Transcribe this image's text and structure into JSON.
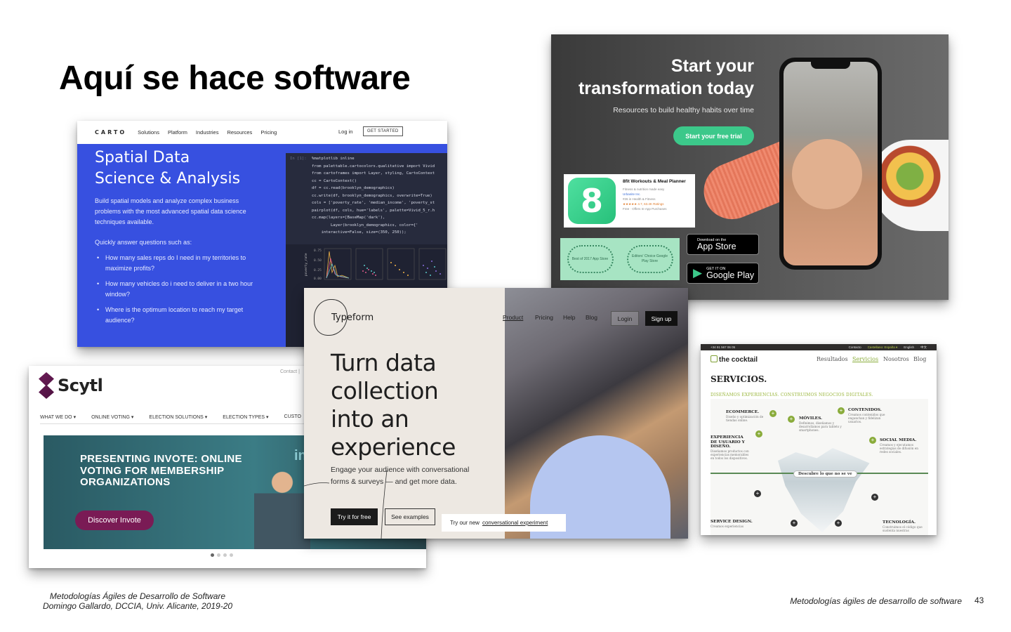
{
  "slide": {
    "title": "Aquí se hace software",
    "footer_line1": "Metodologías Ágiles de Desarrollo de Software",
    "footer_line2": "Domingo Gallardo, DCCIA, Univ. Alicante, 2019-20",
    "footer_right": "Metodologías ágiles de desarrollo de software",
    "page_number": "43"
  },
  "carto": {
    "logo": "CARTO",
    "nav": [
      "Solutions",
      "Platform",
      "Industries",
      "Resources",
      "Pricing"
    ],
    "login": "Log in",
    "cta": "GET STARTED",
    "headline_1": "Spatial Data",
    "headline_2": "Science & Analysis",
    "body": "Build spatial models and analyze complex business problems with the most advanced spatial data science techniques available.",
    "question_intro": "Quickly answer questions such as:",
    "bullets": [
      "How many sales reps do I need in my territories to maximize profits?",
      "How many vehicles do i need to deliver in a two hour window?",
      "Where is the optimum location to reach my target audience?"
    ],
    "code_line_no": "In [1]:",
    "code_lines": [
      "%matplotlib inline",
      "from palettable.cartocolors.qualitative import Vivid",
      "from cartoframes import Layer, styling, CartoContext",
      "cc = CartoContext()",
      "df = cc.read(brooklyn_demographics)",
      "cc.write(df, brooklyn_demographics, overwrite=True)",
      "cols = ['poverty_rate', 'median_income', 'poverty_st",
      "pairplot(df, cols, hue='labels', palette=Vivid_5_r.h",
      "cc.map(layers=[BaseMap('dark'),",
      "        Layer(brooklyn_demographics, color={'",
      "    interactive=False, size=(350, 250));"
    ],
    "plot_ylabel": "poverty_rate",
    "plot_ticks": [
      "0.75",
      "0.50",
      "0.25",
      "0.00"
    ],
    "accent_color": "#3750e0"
  },
  "fit": {
    "headline_1": "Start your",
    "headline_2": "transformation today",
    "subtitle": "Resources to build healthy habits over time",
    "cta": "Start your free trial",
    "app_title": "8fit Workouts & Meal Planner",
    "app_sub_1": "Fitness & nutrition made easy",
    "app_sub_2": "Urbanite Inc.",
    "app_sub_3": "#26 in Health & Fitness",
    "app_sub_4": "★★★★★ 4.7, 63.4K Ratings",
    "app_sub_5": "Free · Offers In-App Purchases",
    "award_1": "Best of 2017 App Store",
    "award_2": "Editors' Choice Google Play Store",
    "appstore_small": "Download on the",
    "appstore_big": "App Store",
    "gplay_small": "GET IT ON",
    "gplay_big": "Google Play",
    "accent_color": "#3cc88a"
  },
  "scytl": {
    "logo": "Scytl",
    "contact": "Contact |",
    "nav": [
      "WHAT WE DO ▾",
      "ONLINE VOTING ▾",
      "ELECTION SOLUTIONS ▾",
      "ELECTION TYPES ▾",
      "CUSTO"
    ],
    "banner_headline": "PRESENTING INVOTE: ONLINE VOTING FOR MEMBERSHIP ORGANIZATIONS",
    "banner_button": "Discover Invote",
    "banner_mark": "in",
    "accent_color": "#7a1b55"
  },
  "typeform": {
    "logo": "Typeform",
    "nav": [
      "Product",
      "Pricing",
      "Help",
      "Blog"
    ],
    "login": "Login",
    "signup": "Sign up",
    "headline_1": "Turn data",
    "headline_2": "collection",
    "headline_3": "into an",
    "headline_4": "experience",
    "subtitle": "Engage your audience with conversational forms & surveys — and get more data.",
    "primary_button": "Try it for free",
    "secondary_button": "See examples",
    "try_text": "Try our new",
    "try_link": "conversational experiment"
  },
  "cocktail": {
    "phone": "+34 91 567 06 05",
    "top_links": [
      "Contacto",
      "Castellano: España ▾",
      "English",
      "中文"
    ],
    "logo": "the cocktail",
    "nav": [
      "Resultados",
      "Servicios",
      "Nosotros",
      "Blog"
    ],
    "heading": "SERVICIOS.",
    "tagline": "DISEÑAMOS EXPERIENCIAS. CONSTRUIMOS NEGOCIOS DIGITALES.",
    "items": [
      {
        "title": "ECOMMERCE.",
        "desc": "Diseño y optimización de tiendas online."
      },
      {
        "title": "MÓVILES.",
        "desc": "Definimos, diseñamos y desarrollamos para tablets y smartphones."
      },
      {
        "title": "CONTENIDOS.",
        "desc": "Creamos contenidos que enganchan y fidelizan usuarios."
      },
      {
        "title": "EXPERIENCIA DE USUARIO Y DISEÑO.",
        "desc": "Diseñamos productos con experiencias memorables en todos los dispositivos."
      },
      {
        "title": "SOCIAL MEDIA.",
        "desc": "Creamos y ejecutamos estrategias de difusión en redes sociales."
      },
      {
        "title": "SERVICE DESIGN.",
        "desc": "Creamos experiencias"
      },
      {
        "title": "TECNOLOGÍA.",
        "desc": "Construimos el código que sustenta nuestras"
      }
    ],
    "discover": "Descubre lo que no se ve",
    "accent_color": "#8aac3b"
  }
}
